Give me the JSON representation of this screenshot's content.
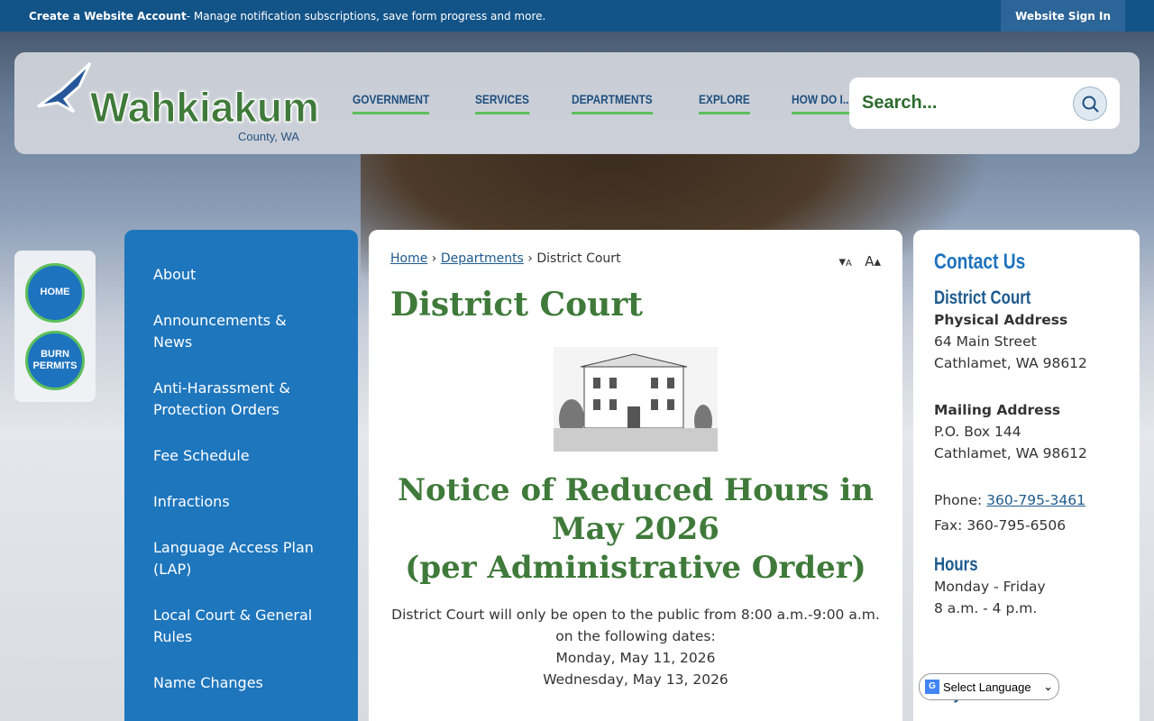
{
  "topbar": {
    "bold": "Create a Website Account",
    "text": " - Manage notification subscriptions, save form progress and more.",
    "signin": "Website Sign In"
  },
  "logo": {
    "name": "Wahkiakum",
    "sub": "County, WA"
  },
  "nav": [
    "GOVERNMENT",
    "SERVICES",
    "DEPARTMENTS",
    "EXPLORE",
    "HOW DO I..."
  ],
  "search": {
    "placeholder": "Search...",
    "icon": "search-icon"
  },
  "quick": [
    "HOME",
    "BURN PERMITS"
  ],
  "sidebar": [
    "About",
    "Announcements & News",
    "Anti-Harassment & Protection Orders",
    "Fee Schedule",
    "Infractions",
    "Language Access Plan (LAP)",
    "Local Court & General Rules",
    "Name Changes"
  ],
  "breadcrumb": {
    "home": "Home",
    "dept": "Departments",
    "current": "District Court"
  },
  "font_size": {
    "decrease": "A",
    "increase": "A"
  },
  "main": {
    "title": "District Court",
    "notice_line1": "Notice of Reduced Hours in May 2026",
    "notice_pre": "(per ",
    "notice_link": "Administrative Order",
    "notice_post": ")",
    "body1": "District Court will only be open to the public from 8:00 a.m.-9:00 a.m. on the following dates:",
    "date1": "Monday, May 11, 2026",
    "date2": "Wednesday, May 13, 2026"
  },
  "contact": {
    "title": "Contact Us",
    "dept": "District Court",
    "phys_label": "Physical Address",
    "phys1": "64 Main Street",
    "phys2": "Cathlamet, WA 98612",
    "mail_label": "Mailing Address",
    "mail1": "P.O. Box 144",
    "mail2": "Cathlamet, WA 98612",
    "phone_label": "Phone: ",
    "phone": "360-795-3461",
    "fax": "Fax: 360-795-6506",
    "hours_label": "Hours",
    "hours1": "Monday - Friday",
    "hours2": "8 a.m. - 4 p.m.",
    "judge_partial": "Heywood"
  },
  "language": {
    "label": "Select Language"
  },
  "colors": {
    "topbar": "#125388",
    "green": "#3f7a3a",
    "blue": "#1e76bd",
    "accent": "#5cbf5c"
  }
}
